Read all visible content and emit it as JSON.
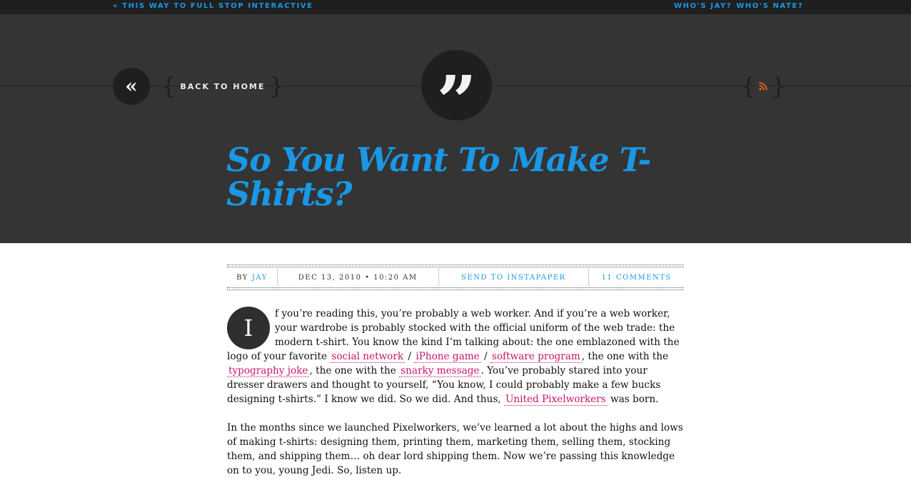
{
  "topbar": {
    "left_link": "« THIS WAY TO FULL STOP INTERACTIVE",
    "right_link_1": "WHO'S JAY?",
    "right_link_2": "WHO'S NATE?"
  },
  "header": {
    "back_icon": "«",
    "back_label": "BACK TO HOME",
    "logo_glyph": "”",
    "rss_icon": "rss-icon",
    "title": "So You Want To Make T-Shirts?"
  },
  "meta": {
    "by_label": "BY",
    "author": "JAY",
    "date": "DEC 13, 2010 • 10:20 AM",
    "instapaper": "SEND TO INSTAPAPER",
    "comments": "11 COMMENTS"
  },
  "article": {
    "dropcap": "I",
    "p1_a": "f you’re reading this, you’re probably a web worker. And if you’re a web worker, your wardrobe is probably stocked with the official uniform of the web trade: the modern t-shirt. You know the kind I’m talking about: the one emblazoned with the logo of your favorite ",
    "link_social": "social network",
    "sep1": " / ",
    "link_iphone": "iPhone game",
    "sep2": " / ",
    "link_software": "software program",
    "p1_b": ", the one with the ",
    "link_typography": "typography joke",
    "p1_c": ", the one with the ",
    "link_snarky": "snarky message",
    "p1_d": ". You’ve probably stared into your dresser drawers and thought to yourself, “You know, I could probably make a few bucks designing t-shirts.” I know we did. So we did. And thus, ",
    "link_upw": "United Pixelworkers",
    "p1_e": " was born.",
    "p2": "In the months since we launched Pixelworkers, we’ve learned a lot about the highs and lows of making t-shirts: designing them, printing them, marketing them, selling them, stocking them, and shipping them… oh dear lord shipping them. Now we’re passing this knowledge on to you, young Jedi. So, listen up."
  },
  "colors": {
    "accent_blue": "#1a97e6",
    "link_pink": "#c4166a",
    "header_bg": "#343434",
    "topbar_bg": "#1f1f1f"
  }
}
